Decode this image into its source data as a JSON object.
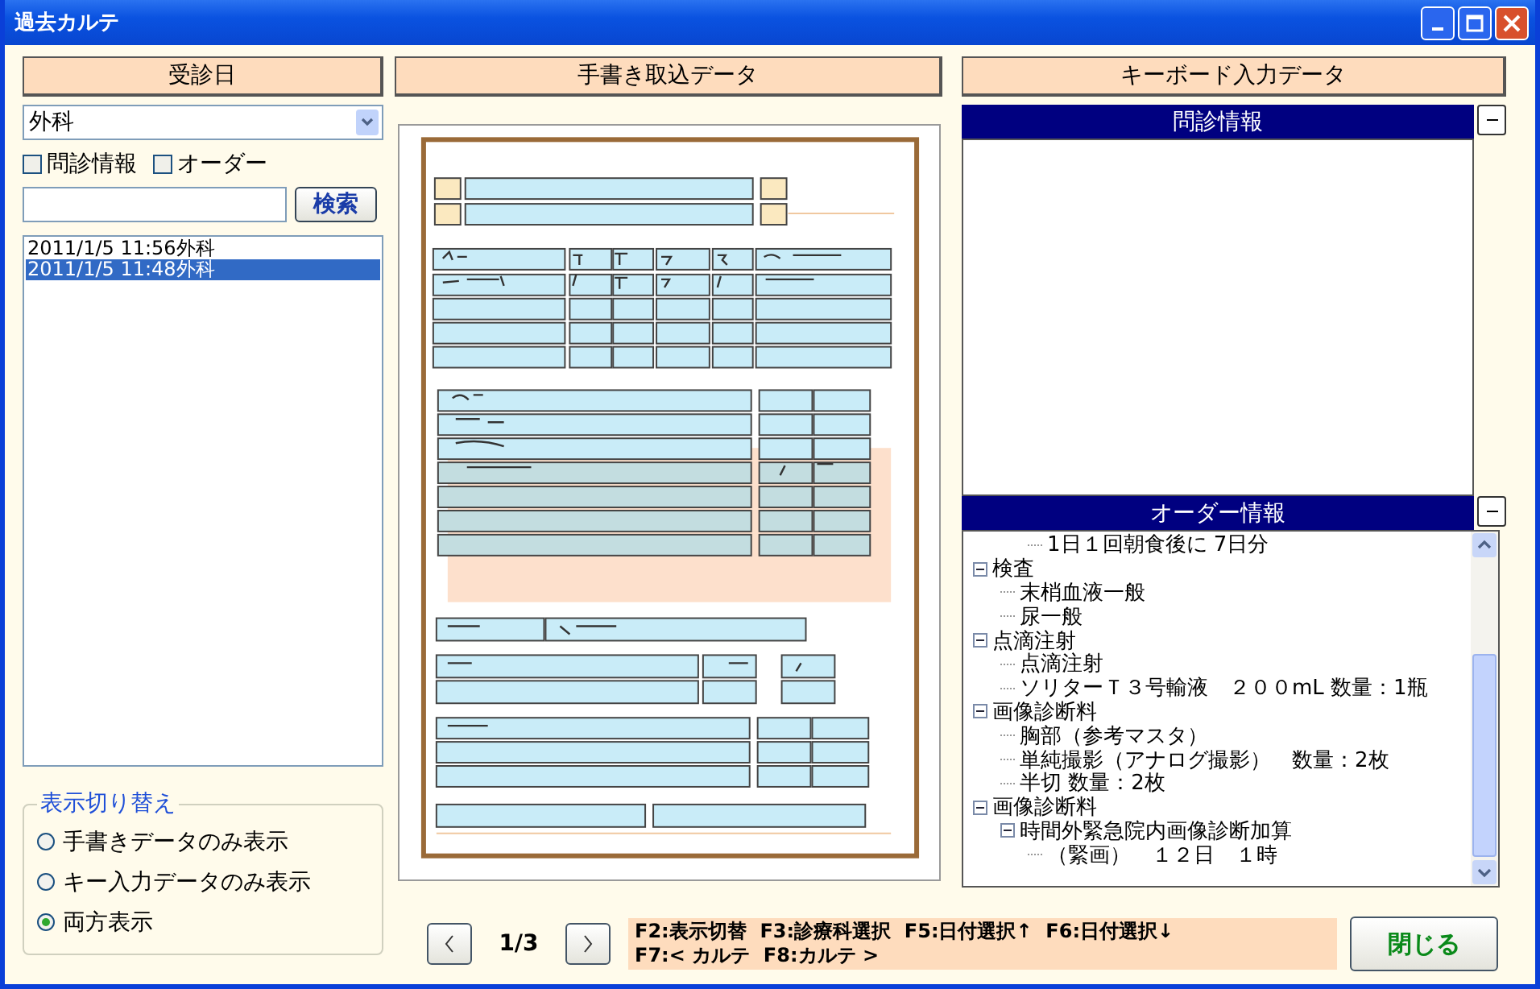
{
  "window": {
    "title": "過去カルテ"
  },
  "left": {
    "header": "受診日",
    "department": {
      "value": "外科"
    },
    "filters": [
      {
        "label": "問診情報",
        "checked": false
      },
      {
        "label": "オーダー",
        "checked": false
      }
    ],
    "search": {
      "button": "検索"
    },
    "visits": [
      {
        "label": "2011/1/5 11:56外科",
        "selected": false
      },
      {
        "label": "2011/1/5 11:48外科",
        "selected": true
      }
    ],
    "display_mode": {
      "title": "表示切り替え",
      "options": [
        {
          "label": "手書きデータのみ表示",
          "selected": false
        },
        {
          "label": "キー入力データのみ表示",
          "selected": false
        },
        {
          "label": "両方表示",
          "selected": true
        }
      ]
    }
  },
  "middle": {
    "header": "手書き取込データ"
  },
  "right": {
    "header": "キーボード入力データ",
    "interview_panel": {
      "title": "問診情報",
      "expanded": true
    },
    "order_panel": {
      "title": "オーダー情報",
      "expanded": true,
      "tree": [
        {
          "children": [
            {
              "children": [
                {
                  "label": "1日１回朝食後に 7日分"
                }
              ]
            }
          ]
        },
        {
          "label": "検査",
          "expanded": true,
          "children": [
            {
              "label": "末梢血液一般"
            },
            {
              "label": "尿一般"
            }
          ]
        },
        {
          "label": "点滴注射",
          "expanded": true,
          "children": [
            {
              "label": "点滴注射"
            },
            {
              "label": "ソリターＴ３号輸液　２００mL 数量：1瓶"
            }
          ]
        },
        {
          "label": "画像診断料",
          "expanded": true,
          "children": [
            {
              "label": "胸部（参考マスタ）"
            },
            {
              "label": "単純撮影（アナログ撮影）　数量：2枚"
            },
            {
              "label": "半切 数量：2枚"
            }
          ]
        },
        {
          "label": "画像診断料",
          "expanded": true,
          "children": [
            {
              "label": "時間外緊急院内画像診断加算",
              "expanded": true,
              "children": [
                {
                  "label": "（緊画）　１２日　１時"
                }
              ]
            }
          ]
        }
      ]
    }
  },
  "footer": {
    "page": "1/3",
    "shortcuts": [
      "F2:表示切替  F3:診療科選択  F5:日付選択↑  F6:日付選択↓",
      "F7:< カルテ  F8:カルテ >"
    ],
    "close_button": "閉じる"
  }
}
